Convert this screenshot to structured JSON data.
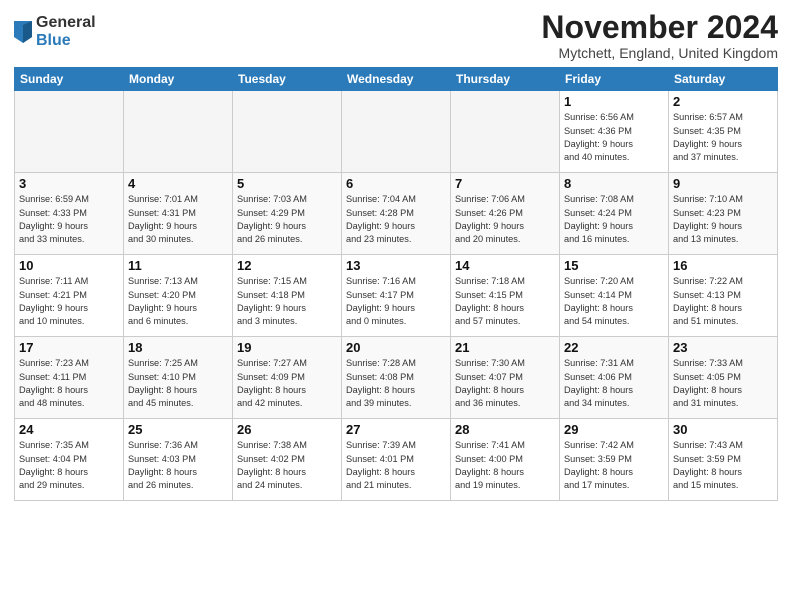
{
  "logo": {
    "general": "General",
    "blue": "Blue"
  },
  "title": "November 2024",
  "location": "Mytchett, England, United Kingdom",
  "days_header": [
    "Sunday",
    "Monday",
    "Tuesday",
    "Wednesday",
    "Thursday",
    "Friday",
    "Saturday"
  ],
  "weeks": [
    [
      {
        "day": "",
        "info": ""
      },
      {
        "day": "",
        "info": ""
      },
      {
        "day": "",
        "info": ""
      },
      {
        "day": "",
        "info": ""
      },
      {
        "day": "",
        "info": ""
      },
      {
        "day": "1",
        "info": "Sunrise: 6:56 AM\nSunset: 4:36 PM\nDaylight: 9 hours\nand 40 minutes."
      },
      {
        "day": "2",
        "info": "Sunrise: 6:57 AM\nSunset: 4:35 PM\nDaylight: 9 hours\nand 37 minutes."
      }
    ],
    [
      {
        "day": "3",
        "info": "Sunrise: 6:59 AM\nSunset: 4:33 PM\nDaylight: 9 hours\nand 33 minutes."
      },
      {
        "day": "4",
        "info": "Sunrise: 7:01 AM\nSunset: 4:31 PM\nDaylight: 9 hours\nand 30 minutes."
      },
      {
        "day": "5",
        "info": "Sunrise: 7:03 AM\nSunset: 4:29 PM\nDaylight: 9 hours\nand 26 minutes."
      },
      {
        "day": "6",
        "info": "Sunrise: 7:04 AM\nSunset: 4:28 PM\nDaylight: 9 hours\nand 23 minutes."
      },
      {
        "day": "7",
        "info": "Sunrise: 7:06 AM\nSunset: 4:26 PM\nDaylight: 9 hours\nand 20 minutes."
      },
      {
        "day": "8",
        "info": "Sunrise: 7:08 AM\nSunset: 4:24 PM\nDaylight: 9 hours\nand 16 minutes."
      },
      {
        "day": "9",
        "info": "Sunrise: 7:10 AM\nSunset: 4:23 PM\nDaylight: 9 hours\nand 13 minutes."
      }
    ],
    [
      {
        "day": "10",
        "info": "Sunrise: 7:11 AM\nSunset: 4:21 PM\nDaylight: 9 hours\nand 10 minutes."
      },
      {
        "day": "11",
        "info": "Sunrise: 7:13 AM\nSunset: 4:20 PM\nDaylight: 9 hours\nand 6 minutes."
      },
      {
        "day": "12",
        "info": "Sunrise: 7:15 AM\nSunset: 4:18 PM\nDaylight: 9 hours\nand 3 minutes."
      },
      {
        "day": "13",
        "info": "Sunrise: 7:16 AM\nSunset: 4:17 PM\nDaylight: 9 hours\nand 0 minutes."
      },
      {
        "day": "14",
        "info": "Sunrise: 7:18 AM\nSunset: 4:15 PM\nDaylight: 8 hours\nand 57 minutes."
      },
      {
        "day": "15",
        "info": "Sunrise: 7:20 AM\nSunset: 4:14 PM\nDaylight: 8 hours\nand 54 minutes."
      },
      {
        "day": "16",
        "info": "Sunrise: 7:22 AM\nSunset: 4:13 PM\nDaylight: 8 hours\nand 51 minutes."
      }
    ],
    [
      {
        "day": "17",
        "info": "Sunrise: 7:23 AM\nSunset: 4:11 PM\nDaylight: 8 hours\nand 48 minutes."
      },
      {
        "day": "18",
        "info": "Sunrise: 7:25 AM\nSunset: 4:10 PM\nDaylight: 8 hours\nand 45 minutes."
      },
      {
        "day": "19",
        "info": "Sunrise: 7:27 AM\nSunset: 4:09 PM\nDaylight: 8 hours\nand 42 minutes."
      },
      {
        "day": "20",
        "info": "Sunrise: 7:28 AM\nSunset: 4:08 PM\nDaylight: 8 hours\nand 39 minutes."
      },
      {
        "day": "21",
        "info": "Sunrise: 7:30 AM\nSunset: 4:07 PM\nDaylight: 8 hours\nand 36 minutes."
      },
      {
        "day": "22",
        "info": "Sunrise: 7:31 AM\nSunset: 4:06 PM\nDaylight: 8 hours\nand 34 minutes."
      },
      {
        "day": "23",
        "info": "Sunrise: 7:33 AM\nSunset: 4:05 PM\nDaylight: 8 hours\nand 31 minutes."
      }
    ],
    [
      {
        "day": "24",
        "info": "Sunrise: 7:35 AM\nSunset: 4:04 PM\nDaylight: 8 hours\nand 29 minutes."
      },
      {
        "day": "25",
        "info": "Sunrise: 7:36 AM\nSunset: 4:03 PM\nDaylight: 8 hours\nand 26 minutes."
      },
      {
        "day": "26",
        "info": "Sunrise: 7:38 AM\nSunset: 4:02 PM\nDaylight: 8 hours\nand 24 minutes."
      },
      {
        "day": "27",
        "info": "Sunrise: 7:39 AM\nSunset: 4:01 PM\nDaylight: 8 hours\nand 21 minutes."
      },
      {
        "day": "28",
        "info": "Sunrise: 7:41 AM\nSunset: 4:00 PM\nDaylight: 8 hours\nand 19 minutes."
      },
      {
        "day": "29",
        "info": "Sunrise: 7:42 AM\nSunset: 3:59 PM\nDaylight: 8 hours\nand 17 minutes."
      },
      {
        "day": "30",
        "info": "Sunrise: 7:43 AM\nSunset: 3:59 PM\nDaylight: 8 hours\nand 15 minutes."
      }
    ]
  ]
}
